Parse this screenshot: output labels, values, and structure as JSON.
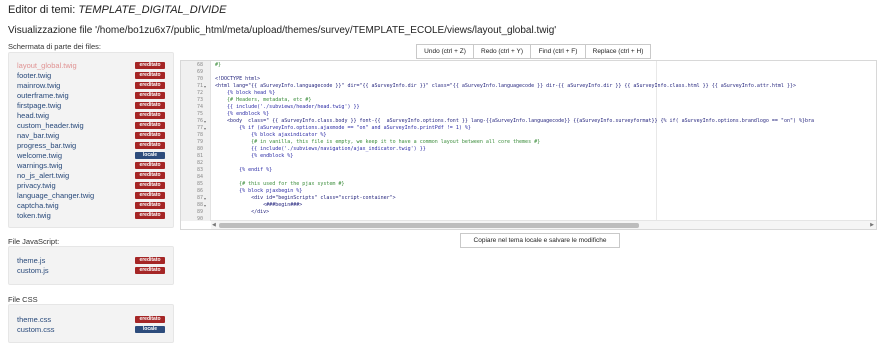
{
  "header": {
    "title_prefix": "Editor di temi: ",
    "template_name": "TEMPLATE_DIGITAL_DIVIDE",
    "subtitle": "Visualizzazione file '/home/bo1zu6x7/public_html/meta/upload/themes/survey/TEMPLATE_ECOLE/views/layout_global.twig'"
  },
  "screen_files": {
    "label": "Schermata di parte dei files:",
    "items": [
      {
        "name": "layout_global.twig",
        "badge": "ereditato",
        "active": true
      },
      {
        "name": "footer.twig",
        "badge": "ereditato"
      },
      {
        "name": "mainrow.twig",
        "badge": "ereditato"
      },
      {
        "name": "outerframe.twig",
        "badge": "ereditato"
      },
      {
        "name": "firstpage.twig",
        "badge": "ereditato"
      },
      {
        "name": "head.twig",
        "badge": "ereditato"
      },
      {
        "name": "custom_header.twig",
        "badge": "ereditato"
      },
      {
        "name": "nav_bar.twig",
        "badge": "ereditato"
      },
      {
        "name": "progress_bar.twig",
        "badge": "ereditato"
      },
      {
        "name": "welcome.twig",
        "badge": "locale"
      },
      {
        "name": "warnings.twig",
        "badge": "ereditato"
      },
      {
        "name": "no_js_alert.twig",
        "badge": "ereditato"
      },
      {
        "name": "privacy.twig",
        "badge": "ereditato"
      },
      {
        "name": "language_changer.twig",
        "badge": "ereditato"
      },
      {
        "name": "captcha.twig",
        "badge": "ereditato"
      },
      {
        "name": "token.twig",
        "badge": "ereditato"
      }
    ]
  },
  "js_files": {
    "label": "File JavaScript:",
    "items": [
      {
        "name": "theme.js",
        "badge": "ereditato"
      },
      {
        "name": "custom.js",
        "badge": "ereditato"
      }
    ]
  },
  "css_files": {
    "label": "File CSS",
    "items": [
      {
        "name": "theme.css",
        "badge": "ereditato"
      },
      {
        "name": "custom.css",
        "badge": "locale"
      }
    ]
  },
  "toolbar": {
    "undo": "Undo (ctrl + Z)",
    "redo": "Redo (ctrl + Y)",
    "find": "Find (ctrl + F)",
    "replace": "Replace (ctrl + H)"
  },
  "editor": {
    "lines": [
      {
        "n": "68",
        "t": "#}",
        "c": "cm"
      },
      {
        "n": "69",
        "t": ""
      },
      {
        "n": "70",
        "t": "<!DOCTYPE html>"
      },
      {
        "n": "71",
        "t": "<html lang=\"{{ aSurveyInfo.languagecode }}\" dir=\"{{ aSurveyInfo.dir }}\" class=\"{{ aSurveyInfo.languagecode }} dir-{{ aSurveyInfo.dir }} {{ aSurveyInfo.class.html }} {{ aSurveyInfo.attr.html }}>",
        "f": true
      },
      {
        "n": "72",
        "t": "    {% block head %}",
        "c": "kw"
      },
      {
        "n": "73",
        "t": "    {# Headers, metadata, etc #}",
        "c": "cm"
      },
      {
        "n": "74",
        "t": "    {{ include('./subviews/header/head.twig') }}",
        "c": "kw"
      },
      {
        "n": "75",
        "t": "    {% endblock %}",
        "c": "kw"
      },
      {
        "n": "76",
        "t": "    <body  class=\" {{ aSurveyInfo.class.body }} font-{{  aSurveyInfo.options.font }} lang-{{aSurveyInfo.languagecode}} {{aSurveyInfo.surveyformat}} {% if( aSurveyInfo.options.brandlogo == \"on\") %}bra",
        "f": true
      },
      {
        "n": "77",
        "t": "        {% if (aSurveyInfo.options.ajaxmode == \"on\" and aSurveyInfo.printPdf != 1) %}",
        "c": "kw",
        "f": true
      },
      {
        "n": "78",
        "t": "            {% block ajaxindicator %}",
        "c": "kw"
      },
      {
        "n": "79",
        "t": "            {# in vanilla, this file is empty, we keep it to have a common layout between all core themes #}",
        "c": "cm"
      },
      {
        "n": "80",
        "t": "            {{ include('./subviews/navigation/ajax_indicator.twig') }}",
        "c": "kw"
      },
      {
        "n": "81",
        "t": "            {% endblock %}",
        "c": "kw"
      },
      {
        "n": "82",
        "t": ""
      },
      {
        "n": "83",
        "t": "        {% endif %}",
        "c": "kw"
      },
      {
        "n": "84",
        "t": ""
      },
      {
        "n": "85",
        "t": "        {# this used for the pjax system #}",
        "c": "cm"
      },
      {
        "n": "86",
        "t": "        {% block pjaxbegin %}",
        "c": "kw"
      },
      {
        "n": "87",
        "t": "            <div id=\"beginScripts\" class=\"script-container\">",
        "f": true
      },
      {
        "n": "88",
        "t": "                <###begin###>",
        "f": true
      },
      {
        "n": "89",
        "t": "            </div>"
      },
      {
        "n": "90",
        "t": ""
      }
    ]
  },
  "copy_button": "Copiare nel tema locale e salvare le modifiche"
}
